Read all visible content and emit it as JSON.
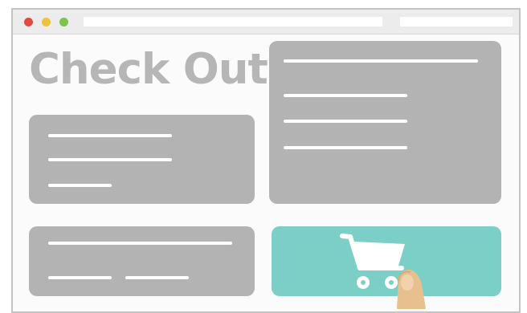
{
  "page": {
    "title": "Check Out"
  },
  "window_controls": [
    "close",
    "minimize",
    "maximize"
  ],
  "colors": {
    "card": "#b3b3b3",
    "accent": "#7bcfc7",
    "title_text": "#b6b6b6",
    "close": "#df4b3d",
    "minimize": "#efc23c",
    "maximize": "#7bc54a"
  },
  "icons": {
    "cart": "shopping-cart-icon",
    "pointer": "pointing-finger-icon"
  }
}
